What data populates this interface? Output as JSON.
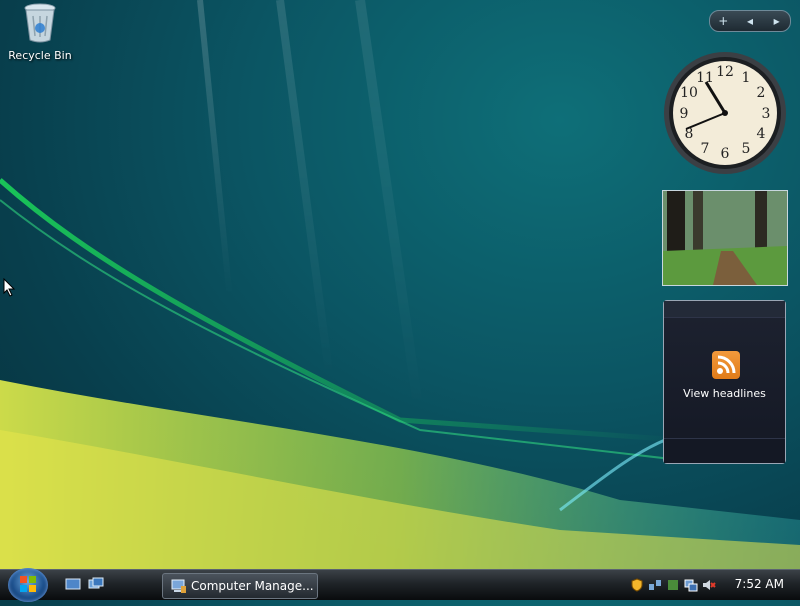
{
  "desktop": {
    "icons": [
      {
        "label": "Recycle Bin"
      }
    ]
  },
  "sidebar": {
    "controls": {
      "add": "+",
      "prev": "◂",
      "next": "▸"
    }
  },
  "gadgets": {
    "feed": {
      "label": "View headlines"
    }
  },
  "taskbar": {
    "running": [
      {
        "label": "Computer Manage..."
      }
    ],
    "clock": "7:52 AM"
  },
  "colors": {
    "rss_orange": "#f08c28",
    "taskbar_dark": "#1f2428"
  }
}
